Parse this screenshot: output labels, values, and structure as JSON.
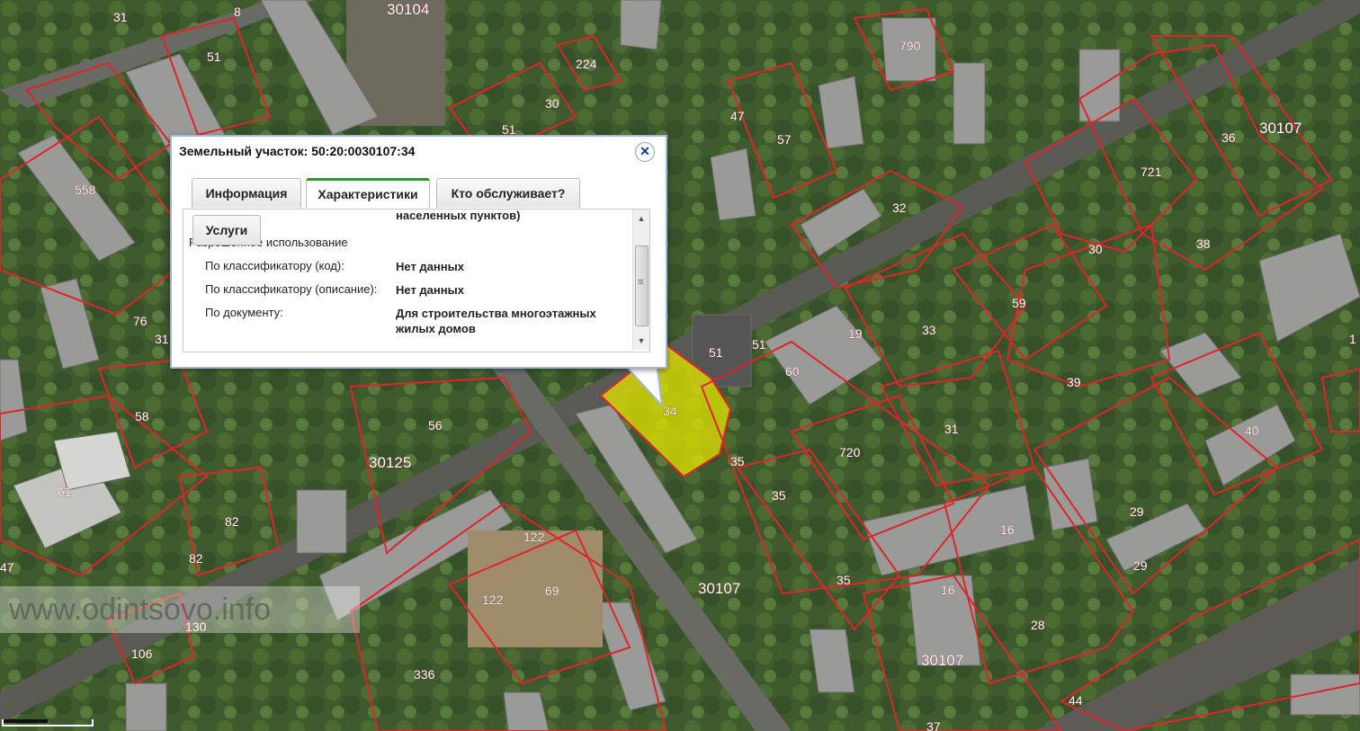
{
  "popup": {
    "title": "Земельный участок: 50:20:0030107:34",
    "close_icon": "close-icon",
    "tabs": [
      {
        "label": "Информация",
        "active": false
      },
      {
        "label": "Характеристики",
        "active": true
      },
      {
        "label": "Кто обслуживает?",
        "active": false
      }
    ],
    "sub_button": "Услуги",
    "rows": {
      "cut_value": "населенных пунктов)",
      "section": "Разрешенное использование",
      "code_label": "По классификатору (код):",
      "code_value": "Нет данных",
      "desc_label": "По классификатору (описание):",
      "desc_value": "Нет данных",
      "doc_label": "По документу:",
      "doc_value": "Для строительства многоэтажных жилых домов"
    }
  },
  "map": {
    "highlight_color": "#e6e600",
    "border_color": "#e0242a",
    "selected_label": "34",
    "labels": [
      "31",
      "30104",
      "8",
      "51",
      "224",
      "30",
      "51",
      "790",
      "57",
      "47",
      "558",
      "76",
      "31",
      "58",
      "61",
      "30125",
      "56",
      "82",
      "82",
      "47",
      "106",
      "130",
      "336",
      "122",
      "122",
      "69",
      "51",
      "51",
      "60",
      "19",
      "32",
      "33",
      "59",
      "30",
      "721",
      "36",
      "30107",
      "38",
      "39",
      "31",
      "720",
      "35",
      "35",
      "35",
      "30107",
      "16",
      "16",
      "28",
      "30107",
      "40",
      "29",
      "29",
      "44",
      "37",
      "1"
    ],
    "watermark": "www.odintsovo.info"
  }
}
